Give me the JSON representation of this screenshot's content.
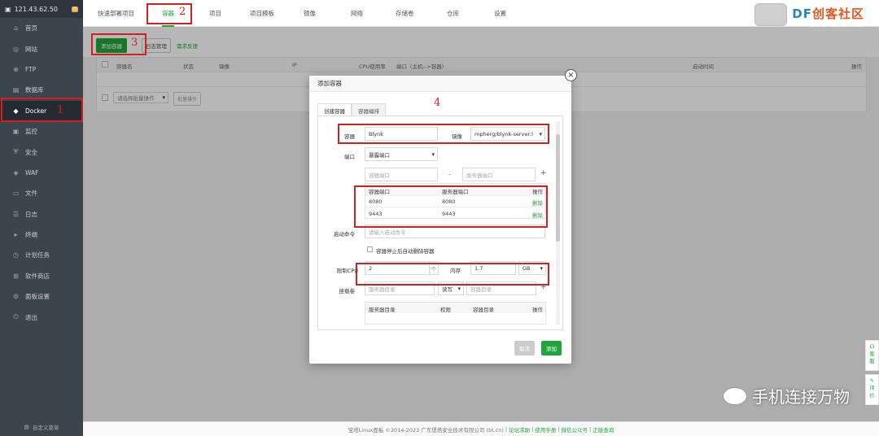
{
  "sidebar": {
    "ip": "121.43.62.50",
    "badge": "0",
    "items": [
      {
        "label": "首页",
        "icon": "home-icon",
        "glyph": "⌂"
      },
      {
        "label": "网站",
        "icon": "globe-icon",
        "glyph": "◎"
      },
      {
        "label": "FTP",
        "icon": "ftp-icon",
        "glyph": "⊕"
      },
      {
        "label": "数据库",
        "icon": "database-icon",
        "glyph": "▤"
      },
      {
        "label": "Docker",
        "icon": "docker-icon",
        "glyph": "◆"
      },
      {
        "label": "监控",
        "icon": "monitor-icon",
        "glyph": "▣"
      },
      {
        "label": "安全",
        "icon": "shield-icon",
        "glyph": "⛨"
      },
      {
        "label": "WAF",
        "icon": "waf-icon",
        "glyph": "◈"
      },
      {
        "label": "文件",
        "icon": "folder-icon",
        "glyph": "▭"
      },
      {
        "label": "日志",
        "icon": "log-icon",
        "glyph": "☰"
      },
      {
        "label": "终端",
        "icon": "terminal-icon",
        "glyph": "▸"
      },
      {
        "label": "计划任务",
        "icon": "clock-icon",
        "glyph": "◷"
      },
      {
        "label": "软件商店",
        "icon": "store-icon",
        "glyph": "⊞"
      },
      {
        "label": "面板设置",
        "icon": "settings-icon",
        "glyph": "⚙"
      },
      {
        "label": "退出",
        "icon": "logout-icon",
        "glyph": "⏻"
      }
    ],
    "custom_menu": "自定义菜单"
  },
  "topnav": {
    "tabs": [
      "快速部署项目",
      "容器",
      "项目",
      "项目模板",
      "镜像",
      "网络",
      "存储卷",
      "仓库",
      "设置"
    ],
    "active": "容器"
  },
  "logo": {
    "brand_df": "DF",
    "brand_text": "创客社区",
    "url": "mc.DFRobot.com.cn"
  },
  "toolbar": {
    "add_container": "添加容器",
    "log_manage": "日志管理",
    "feedback": "需求反馈"
  },
  "table": {
    "headers": [
      "容器名",
      "状态",
      "镜像",
      "IP",
      "CPU使用率",
      "端口（主机-->容器）",
      "启动时间",
      "操作"
    ],
    "batch_select": "请选择批量操作",
    "batch_button": "批量操作"
  },
  "modal": {
    "title": "添加容器",
    "close": "×",
    "tabs": [
      "创建容器",
      "容器编排"
    ],
    "container_label": "容器",
    "container_value": "Blynk",
    "image_label": "镜像",
    "image_value": "mpherg/blynk-server:l",
    "port_label": "端口",
    "port_select": "暴露端口",
    "container_port_ph": "容器端口",
    "dash": "-",
    "server_port_ph": "服务器端口",
    "plus": "+",
    "ports_headers": [
      "容器端口",
      "服务器端口",
      "操作"
    ],
    "ports": [
      {
        "container": "8080",
        "server": "8080",
        "action": "删除"
      },
      {
        "container": "9443",
        "server": "9443",
        "action": "删除"
      }
    ],
    "cmd_label": "启动命令",
    "cmd_ph": "请输入启动命令",
    "auto_remove": "容器停止后自动删除容器",
    "cpu_label": "限制CPU",
    "cpu_value": "2",
    "cpu_unit": "个",
    "mem_label": "内存",
    "mem_value": "1.7",
    "mem_unit": "GB",
    "mount_label": "挂载卷",
    "mount_server_ph": "服务器目录",
    "mount_mode": "读写",
    "mount_container_ph": "容器目录",
    "mount_headers": [
      "服务器目录",
      "权限",
      "容器目录",
      "操作"
    ],
    "cancel": "取消",
    "add": "添加"
  },
  "annotations": [
    "1",
    "2",
    "3",
    "4"
  ],
  "footer": {
    "copyright": "宝塔Linux面板 ©2014-2023 广东堡塔安全技术有限公司 (bt.cn)",
    "links": [
      "论坛求助",
      "使用手册",
      "微信公众号",
      "正版查询"
    ],
    "sep": "|"
  },
  "float": {
    "service": "客服",
    "review": "评价"
  },
  "watermark": "手机连接万物",
  "colors": {
    "accent": "#20a53a",
    "sidebar": "#3c444d",
    "annotation": "#d21f1f"
  }
}
